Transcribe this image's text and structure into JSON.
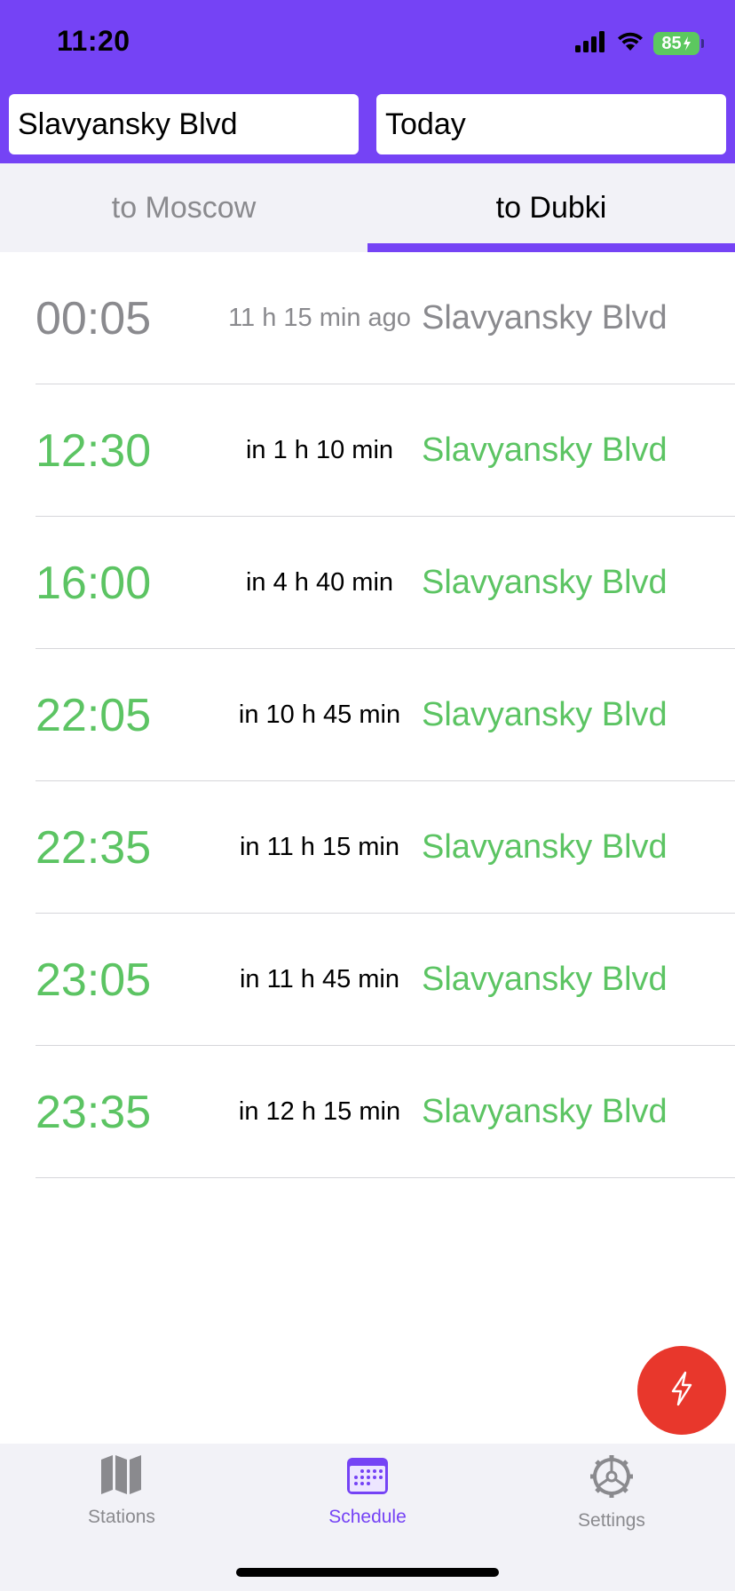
{
  "status_bar": {
    "time": "11:20",
    "battery": "85"
  },
  "header": {
    "station": "Slavyansky Blvd",
    "date": "Today"
  },
  "tabs": [
    {
      "label": "to Moscow",
      "active": false
    },
    {
      "label": "to Dubki",
      "active": true
    }
  ],
  "schedule": [
    {
      "time": "00:05",
      "relative": "11 h 15 min ago",
      "station": "Slavyansky Blvd",
      "past": true
    },
    {
      "time": "12:30",
      "relative": "in 1 h 10 min",
      "station": "Slavyansky Blvd",
      "past": false
    },
    {
      "time": "16:00",
      "relative": "in 4 h 40 min",
      "station": "Slavyansky Blvd",
      "past": false
    },
    {
      "time": "22:05",
      "relative": "in 10 h 45 min",
      "station": "Slavyansky Blvd",
      "past": false
    },
    {
      "time": "22:35",
      "relative": "in 11 h 15 min",
      "station": "Slavyansky Blvd",
      "past": false
    },
    {
      "time": "23:05",
      "relative": "in 11 h 45 min",
      "station": "Slavyansky Blvd",
      "past": false
    },
    {
      "time": "23:35",
      "relative": "in 12 h 15 min",
      "station": "Slavyansky Blvd",
      "past": false
    }
  ],
  "fab": {
    "icon": "lightning-icon",
    "color": "#E8372C"
  },
  "tabbar": {
    "items": [
      {
        "label": "Stations",
        "icon": "map-icon",
        "active": false
      },
      {
        "label": "Schedule",
        "icon": "calendar-icon",
        "active": true
      },
      {
        "label": "Settings",
        "icon": "gear-icon",
        "active": false
      }
    ]
  },
  "colors": {
    "accent": "#7543F5",
    "upcoming": "#5CC463",
    "past": "#8A8A8E"
  }
}
